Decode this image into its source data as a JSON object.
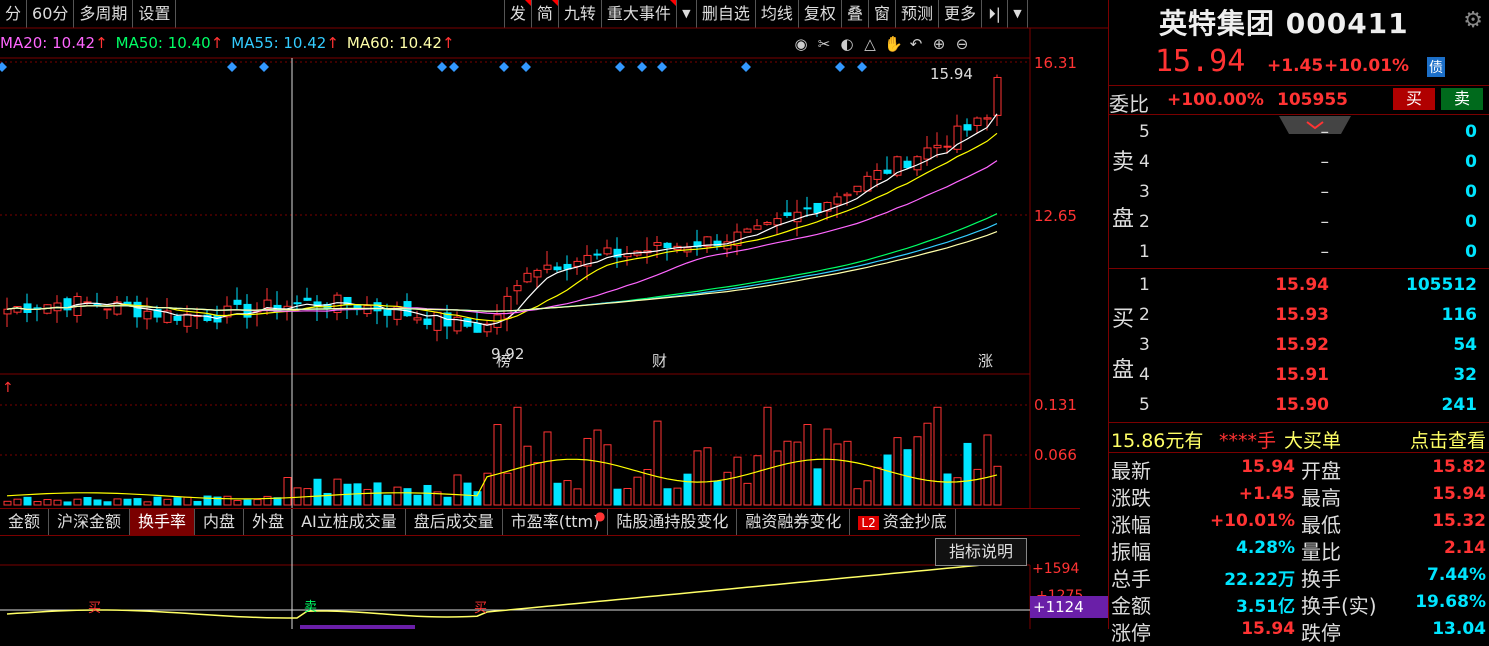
{
  "toolbar": {
    "left": [
      "分",
      "60分",
      "多周期",
      "设置"
    ],
    "right": [
      {
        "label": "发",
        "flag": true
      },
      {
        "label": "简",
        "flag": true
      },
      {
        "label": "九转",
        "flag": false
      },
      {
        "label": "重大事件",
        "flag": true
      },
      {
        "label": "▼",
        "flag": false,
        "dd": true
      },
      {
        "label": "删自选",
        "flag": false
      },
      {
        "label": "均线",
        "flag": false
      },
      {
        "label": "复权",
        "flag": false
      },
      {
        "label": "叠",
        "flag": false
      },
      {
        "label": "窗",
        "flag": false
      },
      {
        "label": "预测",
        "flag": false
      },
      {
        "label": "更多",
        "flag": false
      },
      {
        "label": "⏵|",
        "flag": false,
        "arrow": true
      },
      {
        "label": "▼",
        "flag": false,
        "dd": true
      }
    ]
  },
  "ma": [
    {
      "label": "MA20: 10.42",
      "color": "#ff66ff"
    },
    {
      "label": "MA50: 10.40",
      "color": "#00ff66"
    },
    {
      "label": "MA55: 10.42",
      "color": "#33ccff"
    },
    {
      "label": "MA60: 10.42",
      "color": "#ffffaa"
    }
  ],
  "ma_arrow": "↑",
  "tools": [
    "◉",
    "✂",
    "◐",
    "△",
    "✋",
    "↶",
    "⊕",
    "⊖"
  ],
  "price_axis": {
    "top": "16.31",
    "mid": "12.65"
  },
  "last_price_tag": "15.94",
  "low_tag": "9.92",
  "event_labels": {
    "bang": "榜",
    "cai": "财",
    "zhang": "涨"
  },
  "vol_axis": {
    "top": "0.131",
    "mid": "0.066"
  },
  "vol_label": "↑",
  "ind_axis": {
    "a": "+1594",
    "b": "+1275",
    "c": "+1124"
  },
  "ind_marks": {
    "buy": "买",
    "sell": "卖"
  },
  "ind_tabs": [
    {
      "label": "金额",
      "active": false
    },
    {
      "label": "沪深金额",
      "active": false
    },
    {
      "label": "换手率",
      "active": true
    },
    {
      "label": "内盘",
      "active": false
    },
    {
      "label": "外盘",
      "active": false
    },
    {
      "label": "AI立桩成交量",
      "active": false
    },
    {
      "label": "盘后成交量",
      "active": false
    },
    {
      "label": "市盈率(ttm)",
      "active": false,
      "dot": true
    },
    {
      "label": "陆股通持股变化",
      "active": false
    },
    {
      "label": "融资融券变化",
      "active": false
    },
    {
      "label": "资金抄底",
      "active": false,
      "badge": "L2"
    }
  ],
  "ind_desc_button": "指标说明",
  "quote": {
    "name": "英特集团 000411",
    "price": "15.94",
    "change": "+1.45",
    "change_pct": "+10.01%",
    "bond_tag": "债",
    "weibi_label": "委比",
    "weibi_value": "+100.00%",
    "weibi_diff": "105955",
    "buy_label": "买",
    "sell_label": "卖",
    "sell_side_label": [
      "卖",
      "盘"
    ],
    "buy_side_label": [
      "买",
      "盘"
    ],
    "asks": [
      {
        "level": "5",
        "price": "–",
        "vol": "0"
      },
      {
        "level": "4",
        "price": "–",
        "vol": "0"
      },
      {
        "level": "3",
        "price": "–",
        "vol": "0"
      },
      {
        "level": "2",
        "price": "–",
        "vol": "0"
      },
      {
        "level": "1",
        "price": "–",
        "vol": "0"
      }
    ],
    "bids": [
      {
        "level": "1",
        "price": "15.94",
        "vol": "105512"
      },
      {
        "level": "2",
        "price": "15.93",
        "vol": "116"
      },
      {
        "level": "3",
        "price": "15.92",
        "vol": "54"
      },
      {
        "level": "4",
        "price": "15.91",
        "vol": "32"
      },
      {
        "level": "5",
        "price": "15.90",
        "vol": "241"
      }
    ],
    "big_buy": {
      "price": "15.86元有",
      "qty": "****手",
      "label": "大买单",
      "link": "点击查看"
    },
    "stats": [
      {
        "l1": "最新",
        "v1": "15.94",
        "c1": "red",
        "l2": "开盘",
        "v2": "15.82",
        "c2": "red"
      },
      {
        "l1": "涨跌",
        "v1": "+1.45",
        "c1": "red",
        "l2": "最高",
        "v2": "15.94",
        "c2": "red"
      },
      {
        "l1": "涨幅",
        "v1": "+10.01%",
        "c1": "red",
        "l2": "最低",
        "v2": "15.32",
        "c2": "red"
      },
      {
        "l1": "振幅",
        "v1": "4.28%",
        "c1": "cyan",
        "l2": "量比",
        "v2": "2.14",
        "c2": "red"
      },
      {
        "l1": "总手",
        "v1": "22.22万",
        "c1": "cyan",
        "l2": "换手",
        "v2": "7.44%",
        "c2": "cyan"
      },
      {
        "l1": "金额",
        "v1": "3.51亿",
        "c1": "cyan",
        "l2": "换手(实)",
        "v2": "19.68%",
        "c2": "cyan"
      },
      {
        "l1": "涨停",
        "v1": "15.94",
        "c1": "red",
        "l2": "跌停",
        "v2": "13.04",
        "c2": "cyan"
      }
    ]
  }
}
